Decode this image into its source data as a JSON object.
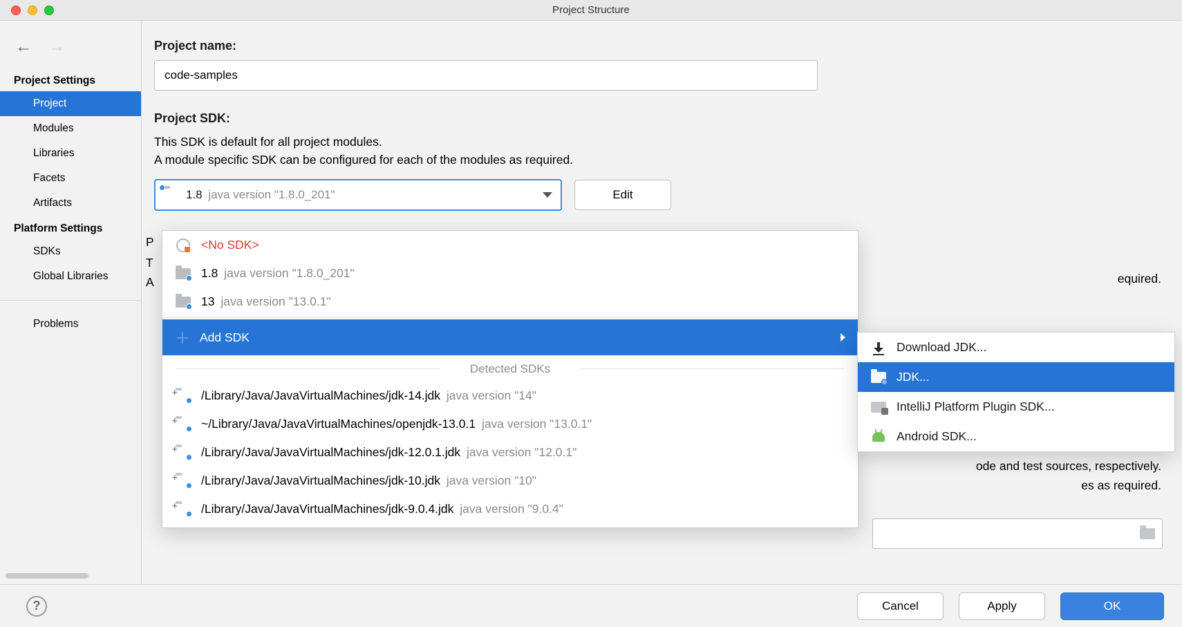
{
  "window": {
    "title": "Project Structure"
  },
  "sidebar": {
    "section1": "Project Settings",
    "section2": "Platform Settings",
    "items1": [
      "Project",
      "Modules",
      "Libraries",
      "Facets",
      "Artifacts"
    ],
    "items2": [
      "SDKs",
      "Global Libraries"
    ],
    "problems": "Problems"
  },
  "main": {
    "project_name_label": "Project name:",
    "project_name_value": "code-samples",
    "project_sdk_label": "Project SDK:",
    "sdk_desc1": "This SDK is default for all project modules.",
    "sdk_desc2": "A module specific SDK can be configured for each of the modules as required.",
    "sdk_selected_name": "1.8",
    "sdk_selected_detail": "java version \"1.8.0_201\"",
    "edit_label": "Edit",
    "peek_p": "P",
    "peek_t": "T",
    "peek_a": "A"
  },
  "dropdown": {
    "no_sdk": "<No SDK>",
    "opt1_name": "1.8",
    "opt1_detail": "java version \"1.8.0_201\"",
    "opt2_name": "13",
    "opt2_detail": "java version \"13.0.1\"",
    "add_sdk": "Add SDK",
    "detected_header": "Detected SDKs",
    "detected": [
      {
        "path": "/Library/Java/JavaVirtualMachines/jdk-14.jdk",
        "ver": "java version \"14\""
      },
      {
        "path": "~/Library/Java/JavaVirtualMachines/openjdk-13.0.1",
        "ver": "java version \"13.0.1\""
      },
      {
        "path": "/Library/Java/JavaVirtualMachines/jdk-12.0.1.jdk",
        "ver": "java version \"12.0.1\""
      },
      {
        "path": "/Library/Java/JavaVirtualMachines/jdk-10.jdk",
        "ver": "java version \"10\""
      },
      {
        "path": "/Library/Java/JavaVirtualMachines/jdk-9.0.4.jdk",
        "ver": "java version \"9.0.4\""
      }
    ]
  },
  "submenu": {
    "download": "Download JDK...",
    "jdk": "JDK...",
    "intellij": "IntelliJ Platform Plugin SDK...",
    "android": "Android SDK..."
  },
  "bg": {
    "required": "equired.",
    "ode_test": "ode and test sources, respectively.",
    "es_required": "es as required."
  },
  "footer": {
    "cancel": "Cancel",
    "apply": "Apply",
    "ok": "OK"
  }
}
